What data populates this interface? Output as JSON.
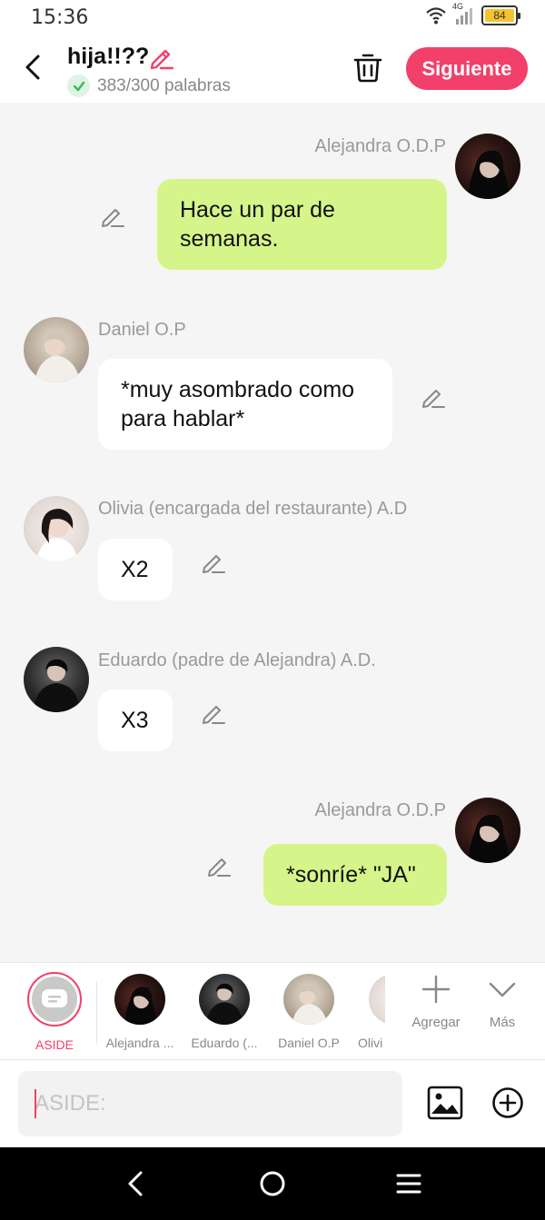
{
  "status": {
    "time": "15:36",
    "network": "4G",
    "battery": "84"
  },
  "header": {
    "title": "hija!!??",
    "word_count": "383/300 palabras",
    "next_label": "Siguiente"
  },
  "messages": [
    {
      "speaker": "Alejandra O.D.P",
      "text": "Hace un par de semanas.",
      "side": "right"
    },
    {
      "speaker": "Daniel O.P",
      "text": "*muy asombrado como para hablar*",
      "side": "left"
    },
    {
      "speaker": "Olivia (encargada del restaurante) A.D",
      "text": "X2",
      "side": "left"
    },
    {
      "speaker": "Eduardo (padre de Alejandra) A.D.",
      "text": "X3",
      "side": "left"
    },
    {
      "speaker": "Alejandra O.D.P",
      "text": "*sonríe* \"JA\"",
      "side": "right"
    }
  ],
  "characters": [
    {
      "label": "ASIDE",
      "selected": true
    },
    {
      "label": "Alejandra ..."
    },
    {
      "label": "Eduardo (..."
    },
    {
      "label": "Daniel O.P"
    },
    {
      "label": "Olivi"
    }
  ],
  "actions": {
    "add_label": "Agregar",
    "more_label": "Más"
  },
  "composer": {
    "placeholder": "ASIDE:"
  },
  "colors": {
    "accent": "#f2406a",
    "bubble_green": "#d5f58a",
    "background": "#f5f5f5"
  },
  "icons": [
    "back-arrow-icon",
    "pencil-icon",
    "check-icon",
    "trash-icon",
    "plus-icon",
    "chevron-down-icon",
    "image-icon",
    "add-circle-icon",
    "nav-back-icon",
    "nav-home-icon",
    "nav-menu-icon"
  ]
}
